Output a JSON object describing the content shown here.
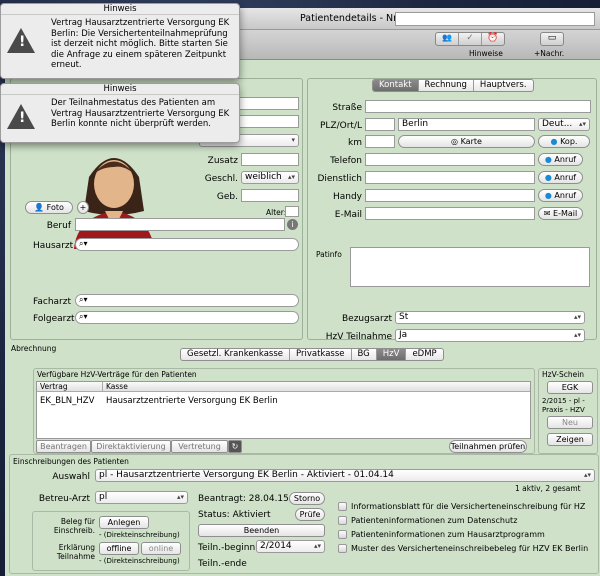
{
  "window": {
    "title": "Patientendetails - Nr.",
    "toolbar": {
      "hinweise": "Hinweise",
      "nachr": "+Nachr."
    }
  },
  "popup1": {
    "title": "Hinweis",
    "message": "Vertrag Hausarztzentrierte Versorgung EK Berlin: Die Versichertenteilnahmeprüfung ist derzeit nicht möglich. Bitte starten Sie die Anfrage zu einem späteren Zeitpunkt erneut."
  },
  "popup2": {
    "title": "Hinweis",
    "message": "Der Teilnahmestatus des Patienten am Vertrag Hausarztzentrierte Versorgung EK Berlin konnte nicht überprüft werden."
  },
  "patient": {
    "zusatz_label": "Zusatz",
    "geschl_label": "Geschl.",
    "geschl_value": "weiblich",
    "geb_label": "Geb.",
    "alter_label": "Alter:",
    "foto_button": "Foto",
    "beruf_label": "Beruf",
    "hausarzt_label": "Hausarzt",
    "facharzt_label": "Facharzt",
    "folgearzt_label": "Folgearzt"
  },
  "contact": {
    "tabs": [
      "Kontakt",
      "Rechnung",
      "Hauptvers."
    ],
    "strasse_label": "Straße",
    "plz_label": "PLZ/Ort/L",
    "ort_value": "Berlin",
    "land_value": "Deut...",
    "km_label": "km",
    "karte_button": "Karte",
    "kop_button": "Kop.",
    "telefon_label": "Telefon",
    "dienstlich_label": "Dienstlich",
    "handy_label": "Handy",
    "email_label": "E-Mail",
    "anruf_button": "Anruf",
    "email_button": "E-Mail",
    "patinfo_label": "Patinfo",
    "bezugsarzt_label": "Bezugsarzt",
    "bezugsarzt_value": "St",
    "hzv_label": "HzV Teilnahme",
    "hzv_value": "Ja"
  },
  "abrechnung": {
    "title": "Abrechnung",
    "tabs": [
      "Gesetzl. Krankenkasse",
      "Privatkasse",
      "BG",
      "HzV",
      "eDMP"
    ],
    "vertraege_title": "Verfügbare HzV-Verträge für den Patienten",
    "columns": [
      "Vertrag",
      "Kasse"
    ],
    "rows": [
      [
        "EK_BLN_HZV",
        "Hausarztzentrierte Versorgung EK Berlin"
      ]
    ],
    "buttons": {
      "beantragen": "Beantragen",
      "direkt": "Direktaktivierung",
      "vertretung": "Vertretung",
      "teilnahmen": "Teilnahmen prüfen"
    },
    "schein_title": "HzV-Schein",
    "egk": "EGK",
    "schein_text": "2/2015 - pl - Praxis - HZV",
    "neu": "Neu",
    "zeigen": "Zeigen"
  },
  "einschreibungen": {
    "title": "Einschreibungen des Patienten",
    "auswahl_label": "Auswahl",
    "auswahl_value": "pl - Hausarztzentrierte Versorgung EK Berlin - Aktiviert - 01.04.14",
    "count_text": "1 aktiv, 2 gesamt",
    "betreu_label": "Betreu-Arzt",
    "betreu_value": "pl",
    "beantragt_label": "Beantragt: 28.04.15",
    "storno": "Storno",
    "status_label": "Status: Aktiviert",
    "pruefe": "Prüfe",
    "beenden": "Beenden",
    "beginn_label": "Teiln.-beginn",
    "beginn_value": "2/2014",
    "ende_label": "Teiln.-ende",
    "beleg_label": "Beleg für Einschreib.",
    "anlegen": "Anlegen",
    "direkt_note": "- (Direkteinschreibung)",
    "erklaerung_label": "Erklärung Teilnahme",
    "offline": "offline",
    "online": "online",
    "docs": [
      "Informationsblatt für die Versicherteneinschreibung für HZ",
      "Patienteninformationen zum Datenschutz",
      "Patienteninformationen zum Hausarztprogramm",
      "Muster des Versicherteneinschreibebeleg für HZV EK Berlin"
    ]
  }
}
